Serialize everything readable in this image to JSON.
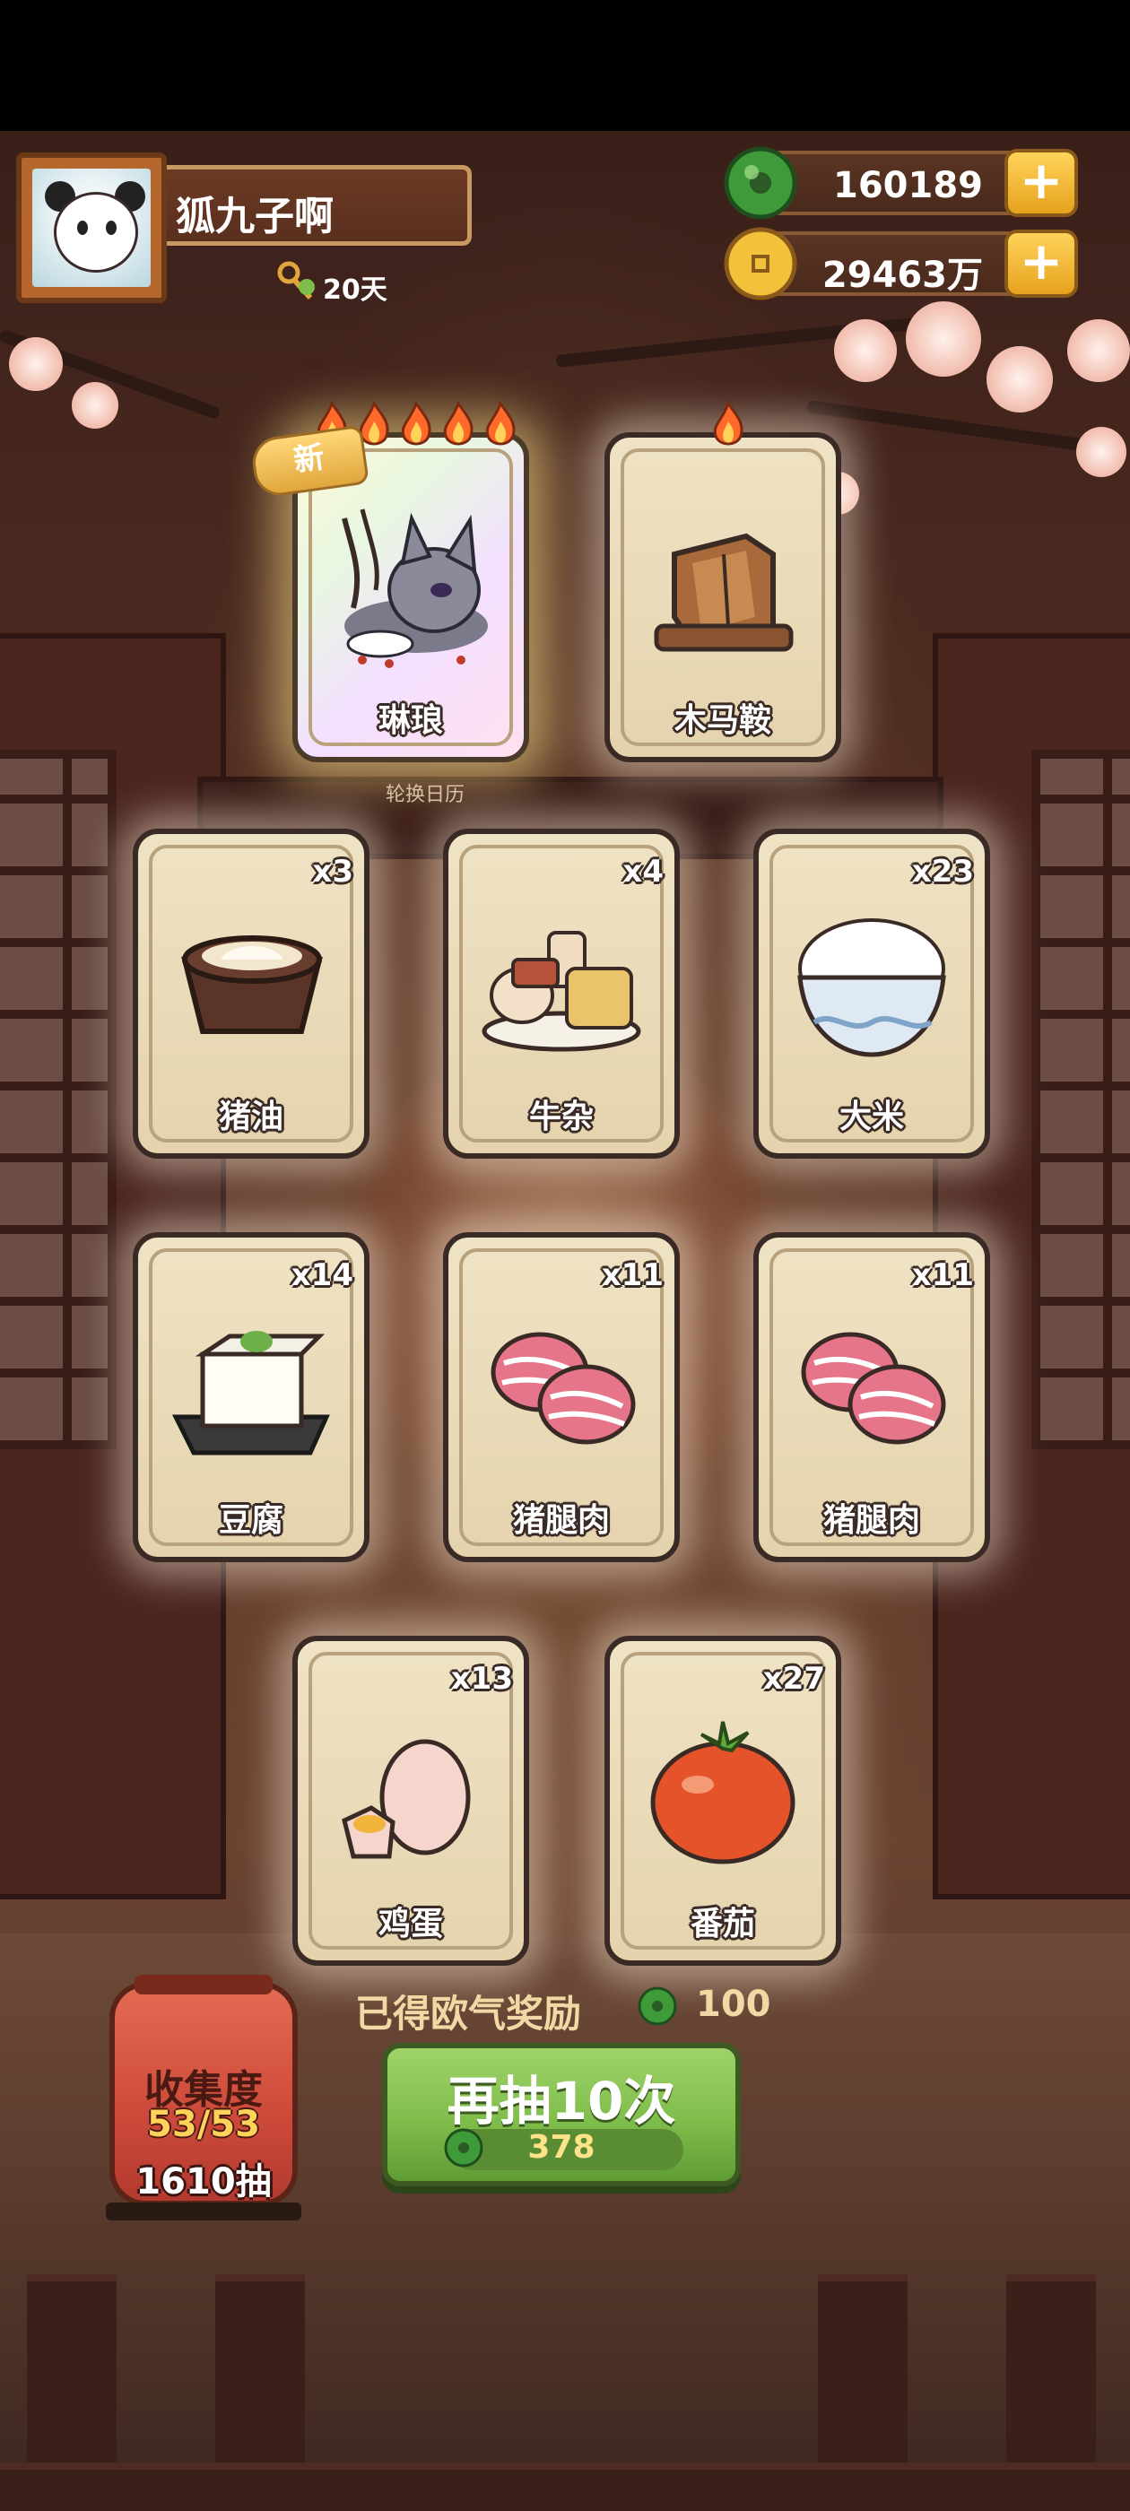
{
  "profile": {
    "name": "狐九子啊",
    "days": "20天"
  },
  "currency": {
    "jade": "160189",
    "coins": "29463万",
    "plus": "+"
  },
  "featured": [
    {
      "name": "琳琅",
      "badge": "新",
      "flames": 5,
      "icon": "fox-character-icon"
    },
    {
      "name": "木马鞍",
      "flames": 1,
      "icon": "wooden-saddle-icon"
    }
  ],
  "featured_caption": "轮换日历",
  "items": [
    {
      "name": "猪油",
      "count": "x3",
      "icon": "lard-bowl-icon"
    },
    {
      "name": "牛杂",
      "count": "x4",
      "icon": "beef-offal-icon"
    },
    {
      "name": "大米",
      "count": "x23",
      "icon": "rice-bowl-icon"
    },
    {
      "name": "豆腐",
      "count": "x14",
      "icon": "tofu-icon"
    },
    {
      "name": "猪腿肉",
      "count": "x11",
      "icon": "pork-leg-icon"
    },
    {
      "name": "猪腿肉",
      "count": "x11",
      "icon": "pork-leg-icon"
    },
    {
      "name": "鸡蛋",
      "count": "x13",
      "icon": "egg-icon"
    },
    {
      "name": "番茄",
      "count": "x27",
      "icon": "tomato-icon"
    }
  ],
  "reward": {
    "label": "已得欧气奖励",
    "value": "100"
  },
  "draw_button": {
    "label": "再抽10次",
    "cost": "378"
  },
  "collection": {
    "title": "收集度",
    "progress": "53/53",
    "draws": "1610抽"
  },
  "colors": {
    "button_green": "#7fbd4b",
    "card_bg": "#e4d3ad",
    "gold": "#ffd35a",
    "jade": "#3f9a3a"
  }
}
